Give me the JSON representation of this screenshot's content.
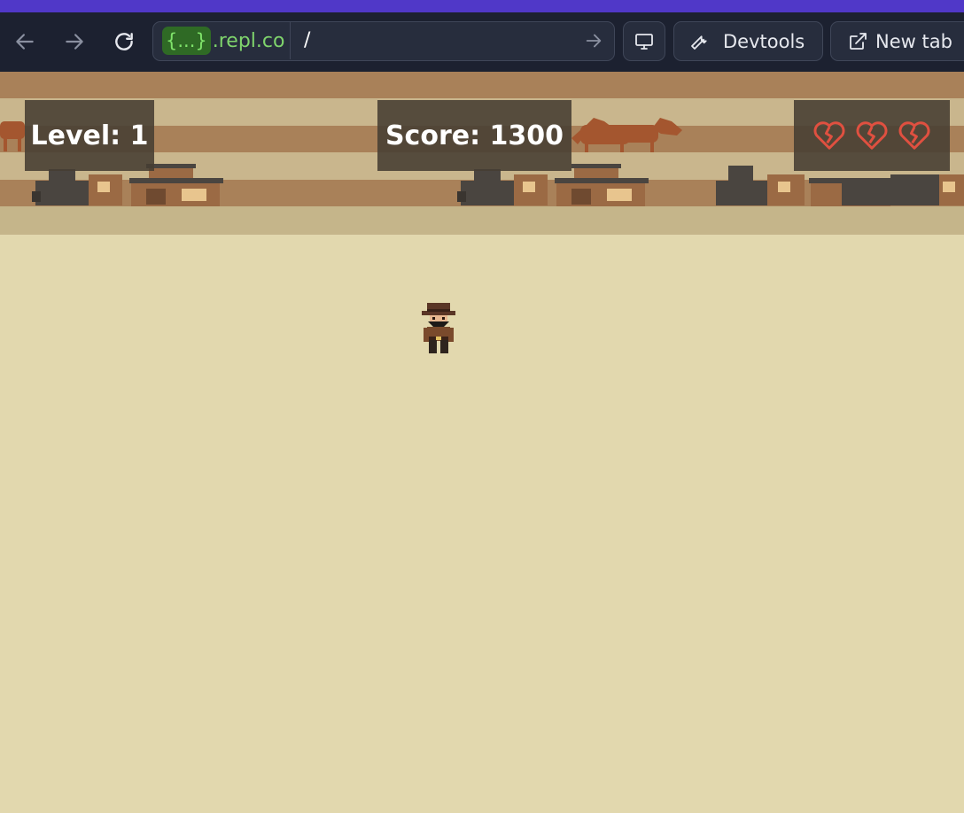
{
  "browser": {
    "url_badge": "{...}",
    "url_domain": ".repl.co",
    "url_path": "/",
    "devtools_label": "Devtools",
    "new_tab_label": "New tab",
    "icons": [
      "back-arrow-icon",
      "forward-arrow-icon",
      "reload-icon",
      "go-arrow-icon",
      "monitor-icon",
      "wrench-icon",
      "external-link-icon"
    ]
  },
  "game": {
    "level_text": "Level: 1",
    "score_text": "Score: 1300",
    "lives_total": 3,
    "lives_icon": "broken-heart-icon"
  },
  "colors": {
    "accent": "#5038c8",
    "browser_bg": "#1c2130",
    "url_green": "#7fd46c",
    "sand": "#e2d8ae",
    "hud_bg": "#463e32",
    "heart_red": "#e05040"
  }
}
